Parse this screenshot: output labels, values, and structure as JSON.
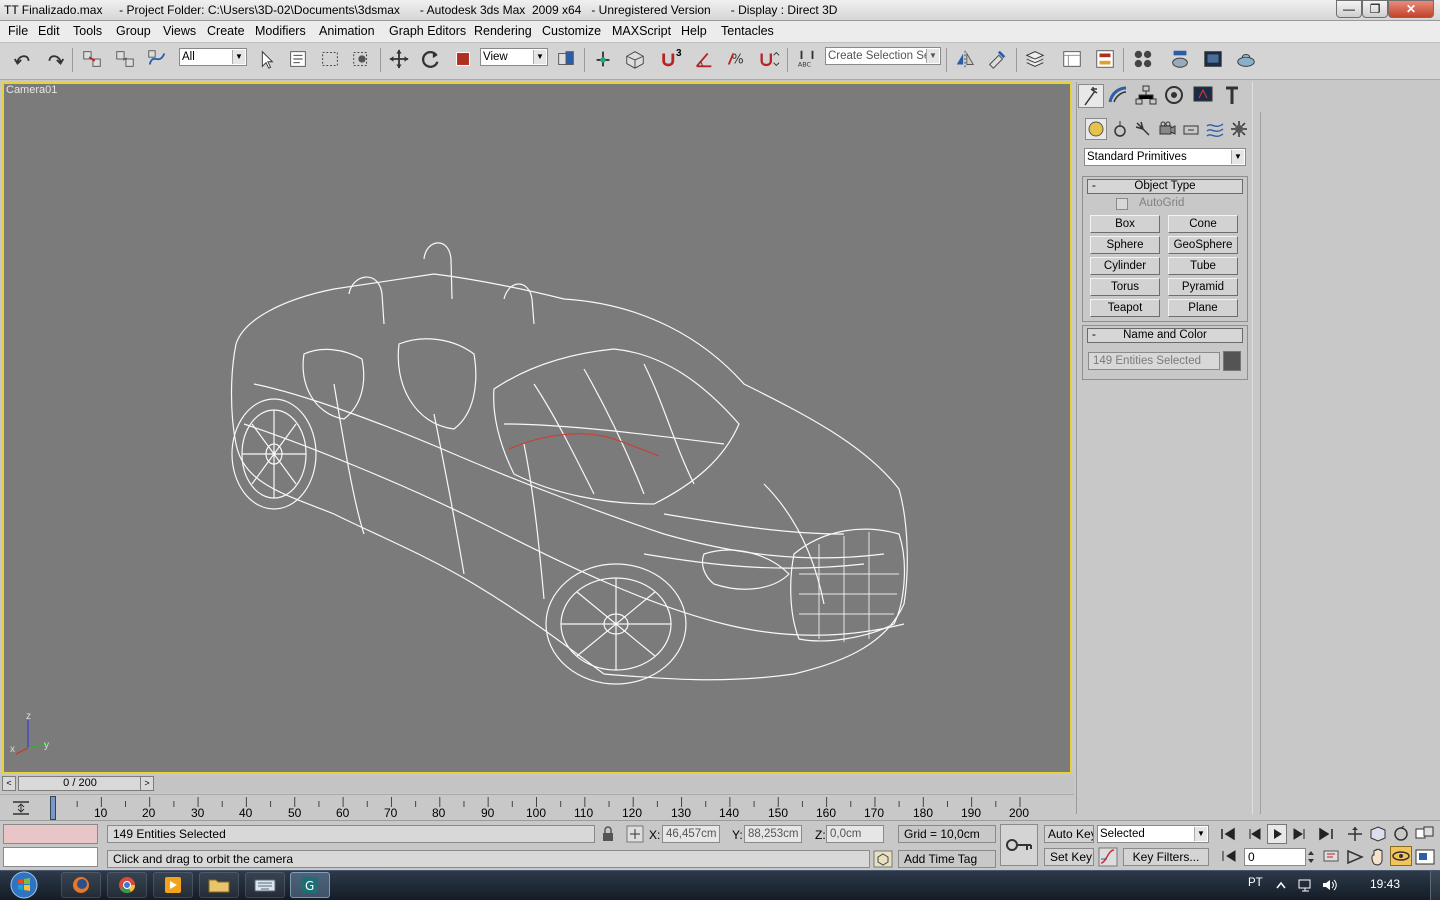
{
  "window": {
    "title": "TT Finalizado.max     - Project Folder: C:\\Users\\3D-02\\Documents\\3dsmax      - Autodesk 3ds Max  2009 x64   - Unregistered Version      - Display : Direct 3D",
    "minimize": "—",
    "maximize": "❐",
    "close": "✕"
  },
  "menu": [
    "File",
    "Edit",
    "Tools",
    "Group",
    "Views",
    "Create",
    "Modifiers",
    "Animation",
    "Graph Editors",
    "Rendering",
    "Customize",
    "MAXScript",
    "Help",
    "Tentacles"
  ],
  "toolbar": {
    "selection_filter": "All",
    "reference_coord": "View",
    "selection_set_placeholder": "Create Selection Set",
    "snap_angle_label": "3"
  },
  "viewport": {
    "label": "Camera01",
    "axis_x": "x",
    "axis_y": "y",
    "axis_z": "z"
  },
  "command_panel": {
    "category_dropdown": "Standard Primitives",
    "object_type_title": "Object Type",
    "rollout_minus": "-",
    "autogrid": "AutoGrid",
    "primitives": [
      "Box",
      "Cone",
      "Sphere",
      "GeoSphere",
      "Cylinder",
      "Tube",
      "Torus",
      "Pyramid",
      "Teapot",
      "Plane"
    ],
    "name_color_title": "Name and Color",
    "name_value": "149 Entities Selected",
    "object_color": "#545454"
  },
  "time_slider": {
    "frame_display": "0 / 200",
    "prev": "<",
    "next": ">"
  },
  "trackbar": {
    "ticks": [
      "10",
      "20",
      "30",
      "40",
      "50",
      "60",
      "70",
      "80",
      "90",
      "100",
      "110",
      "120",
      "130",
      "140",
      "150",
      "160",
      "170",
      "180",
      "190",
      "200"
    ]
  },
  "status": {
    "selection_info": "149 Entities Selected",
    "prompt": "Click and drag to orbit the camera",
    "x_label": "X:",
    "x_value": "46,457cm",
    "y_label": "Y:",
    "y_value": "88,253cm",
    "z_label": "Z:",
    "z_value": "0,0cm",
    "grid": "Grid = 10,0cm",
    "add_time_tag": "Add Time Tag",
    "auto_key": "Auto Key",
    "set_key": "Set Key",
    "key_mode_dropdown": "Selected",
    "key_filters": "Key Filters...",
    "current_frame": "0"
  },
  "taskbar": {
    "language": "PT",
    "clock": "19:43"
  }
}
